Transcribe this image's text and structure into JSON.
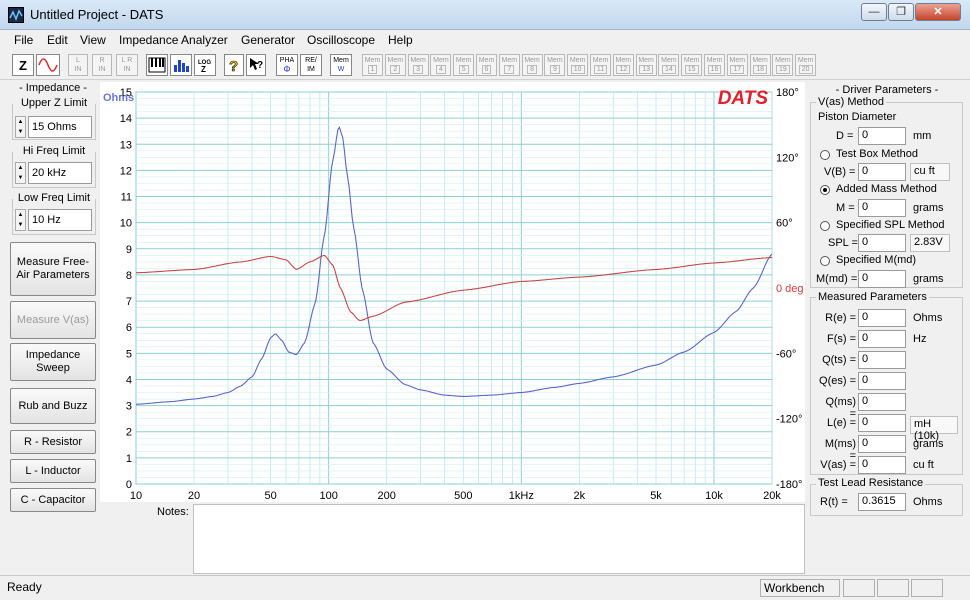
{
  "window": {
    "title": "Untitled Project - DATS",
    "min": "—",
    "restore": "❐",
    "close": "✕"
  },
  "menu": [
    "File",
    "Edit",
    "View",
    "Impedance Analyzer",
    "Generator",
    "Oscilloscope",
    "Help"
  ],
  "toolbar": {
    "z_label": "Z",
    "channel_buttons": [
      [
        "L",
        "IN"
      ],
      [
        "R",
        "IN"
      ],
      [
        "L R",
        "IN"
      ]
    ],
    "pha_label": [
      "PHA",
      "Φ"
    ],
    "reim_label": [
      "RE/",
      "IM"
    ],
    "mem_label": [
      "Mem",
      "W"
    ],
    "memories": [
      "1",
      "2",
      "3",
      "4",
      "5",
      "6",
      "7",
      "8",
      "9",
      "10",
      "11",
      "12",
      "13",
      "14",
      "15",
      "16",
      "17",
      "18",
      "19",
      "20"
    ],
    "mem_prefix": "Mem"
  },
  "left": {
    "impedance_title": "- Impedance -",
    "upper_z_title": "Upper Z Limit",
    "upper_z_value": "15 Ohms",
    "hi_freq_title": "Hi Freq Limit",
    "hi_freq_value": "20 kHz",
    "low_freq_title": "Low Freq Limit",
    "low_freq_value": "10 Hz",
    "buttons": [
      {
        "label": "Measure Free-Air Parameters",
        "disabled": false
      },
      {
        "label": "Measure V(as)",
        "disabled": true
      },
      {
        "label": "Impedance Sweep",
        "disabled": false
      },
      {
        "label": "Rub and Buzz",
        "disabled": false
      },
      {
        "label": "R - Resistor",
        "disabled": false
      },
      {
        "label": "L - Inductor",
        "disabled": false
      },
      {
        "label": "C - Capacitor",
        "disabled": false
      }
    ]
  },
  "chart_data": {
    "type": "line",
    "logo": "DATS",
    "ylabel": "Ohms",
    "y_left_ticks": [
      "15",
      "14",
      "13",
      "12",
      "11",
      "10",
      "9",
      "8",
      "7",
      "6",
      "5",
      "4",
      "3",
      "2",
      "1",
      "0"
    ],
    "y_right_ticks": [
      "180°",
      "120°",
      "60°",
      "0 deg",
      "-60°",
      "-120°",
      "-180°"
    ],
    "x_ticks": [
      {
        "label": "10",
        "f": 10
      },
      {
        "label": "20",
        "f": 20
      },
      {
        "label": "50",
        "f": 50
      },
      {
        "label": "100",
        "f": 100
      },
      {
        "label": "200",
        "f": 200
      },
      {
        "label": "500",
        "f": 500
      },
      {
        "label": "1kHz",
        "f": 1000
      },
      {
        "label": "2k",
        "f": 2000
      },
      {
        "label": "5k",
        "f": 5000
      },
      {
        "label": "10k",
        "f": 10000
      },
      {
        "label": "20k",
        "f": 20000
      }
    ],
    "xlim": [
      10,
      20000
    ],
    "ylim": [
      0,
      15
    ],
    "phase_lim": [
      -180,
      180
    ],
    "x_scale": "log",
    "grid": true,
    "series": [
      {
        "color": "#5b66c9",
        "axis": "left",
        "points": [
          [
            10,
            3.05
          ],
          [
            15,
            3.15
          ],
          [
            20,
            3.25
          ],
          [
            25,
            3.35
          ],
          [
            30,
            3.5
          ],
          [
            35,
            3.75
          ],
          [
            40,
            4.1
          ],
          [
            45,
            4.8
          ],
          [
            50,
            5.6
          ],
          [
            53,
            5.75
          ],
          [
            57,
            5.5
          ],
          [
            62,
            5.05
          ],
          [
            68,
            4.95
          ],
          [
            75,
            5.4
          ],
          [
            85,
            6.9
          ],
          [
            95,
            9.5
          ],
          [
            105,
            12.4
          ],
          [
            113,
            13.7
          ],
          [
            118,
            13.3
          ],
          [
            125,
            11.8
          ],
          [
            135,
            9.8
          ],
          [
            150,
            7.4
          ],
          [
            170,
            5.4
          ],
          [
            200,
            4.4
          ],
          [
            250,
            3.8
          ],
          [
            300,
            3.6
          ],
          [
            400,
            3.4
          ],
          [
            500,
            3.35
          ],
          [
            700,
            3.4
          ],
          [
            1000,
            3.5
          ],
          [
            1500,
            3.7
          ],
          [
            2000,
            3.85
          ],
          [
            3000,
            4.1
          ],
          [
            5000,
            4.55
          ],
          [
            7000,
            5.05
          ],
          [
            10000,
            5.8
          ],
          [
            13000,
            6.6
          ],
          [
            16000,
            7.5
          ],
          [
            20000,
            8.8
          ]
        ]
      },
      {
        "color": "#c84848",
        "axis": "right",
        "points": [
          [
            10,
            14
          ],
          [
            20,
            17
          ],
          [
            35,
            24
          ],
          [
            50,
            29
          ],
          [
            60,
            26
          ],
          [
            68,
            17
          ],
          [
            80,
            24
          ],
          [
            95,
            30
          ],
          [
            105,
            21
          ],
          [
            115,
            0
          ],
          [
            130,
            -22
          ],
          [
            145,
            -30
          ],
          [
            170,
            -26
          ],
          [
            250,
            -13
          ],
          [
            500,
            -2
          ],
          [
            1000,
            6
          ],
          [
            2000,
            10
          ],
          [
            5000,
            17
          ],
          [
            10000,
            23
          ],
          [
            20000,
            28
          ]
        ]
      }
    ]
  },
  "right": {
    "driver_title": "- Driver Parameters -",
    "vas_title": "V(as) Method",
    "piston_label": "Piston Diameter",
    "d_label": "D =",
    "d_value": "0",
    "d_unit": "mm",
    "test_box_label": "Test Box Method",
    "vb_label": "V(B) =",
    "vb_value": "0",
    "vb_unit": "cu ft",
    "added_mass_label": "Added Mass Method",
    "m_label": "M =",
    "m_value": "0",
    "m_unit": "grams",
    "spl_method_label": "Specified SPL Method",
    "spl_label": "SPL =",
    "spl_value": "0",
    "spl_unit": "2.83V",
    "mmd_method_label": "Specified M(md)",
    "mmd_label": "M(md) =",
    "mmd_value": "0",
    "mmd_unit": "grams",
    "measured_title": "Measured Parameters",
    "measured": [
      {
        "label": "R(e) =",
        "value": "0",
        "unit": "Ohms"
      },
      {
        "label": "F(s) =",
        "value": "0",
        "unit": "Hz"
      },
      {
        "label": "Q(ts) =",
        "value": "0",
        "unit": ""
      },
      {
        "label": "Q(es) =",
        "value": "0",
        "unit": ""
      },
      {
        "label": "Q(ms) =",
        "value": "0",
        "unit": ""
      },
      {
        "label": "L(e) =",
        "value": "0",
        "unit": "mH (10k)"
      },
      {
        "label": "M(ms) =",
        "value": "0",
        "unit": "grams"
      },
      {
        "label": "V(as) =",
        "value": "0",
        "unit": "cu ft"
      }
    ],
    "test_lead_title": "Test Lead Resistance",
    "rt_label": "R(t) =",
    "rt_value": "0.3615",
    "rt_unit": "Ohms"
  },
  "notes_label": "Notes:",
  "status": {
    "left": "Ready",
    "right": "Workbench"
  }
}
